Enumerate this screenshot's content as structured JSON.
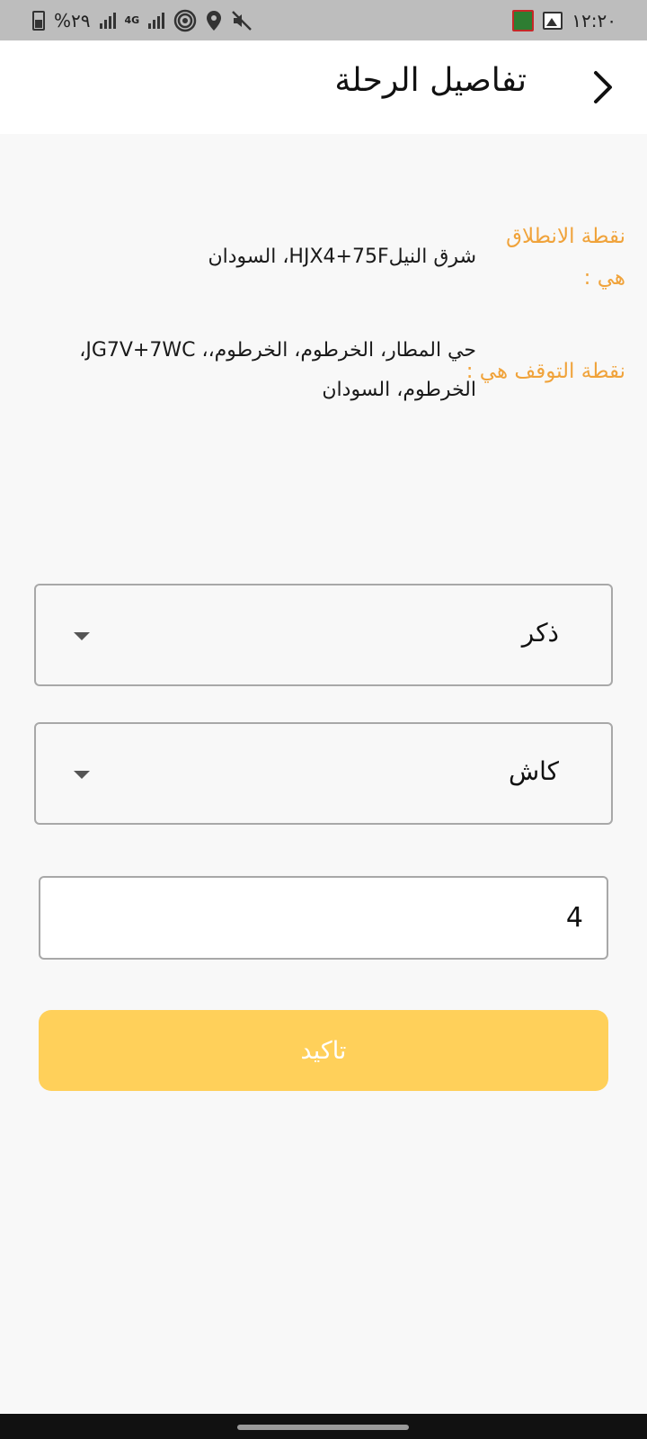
{
  "status_bar": {
    "battery_text": "%٢٩",
    "network_label": "4G",
    "time": "١٢:٢٠",
    "left_icons": [
      "battery-icon",
      "signal-icon",
      "signal-4g-icon",
      "hotspot-icon",
      "location-icon",
      "mute-icon"
    ],
    "right_icons": [
      "book-app-icon",
      "image-icon"
    ]
  },
  "app_bar": {
    "title": "تفاصيل الرحلة",
    "back_icon": "chevron-right-icon"
  },
  "trip": {
    "start_label_line1": "نقطة الانطلاق",
    "start_label_line2": "هي :",
    "start_value": "شرق النيلHJX4+75F، السودان",
    "stop_label": "نقطة التوقف هي :",
    "stop_value_line1": "حي المطار، الخرطوم، الخرطوم،، JG7V+7WC،",
    "stop_value_line2": "الخرطوم، السودان"
  },
  "form": {
    "gender_value": "ذكر",
    "payment_value": "كاش",
    "count_value": "4",
    "confirm_label": "تاكيد"
  },
  "colors": {
    "accent_label": "#f0a33b",
    "button_bg": "#ffd05a",
    "app_bar_bg": "#ffffff",
    "status_bar_bg": "#bdbdbd"
  }
}
